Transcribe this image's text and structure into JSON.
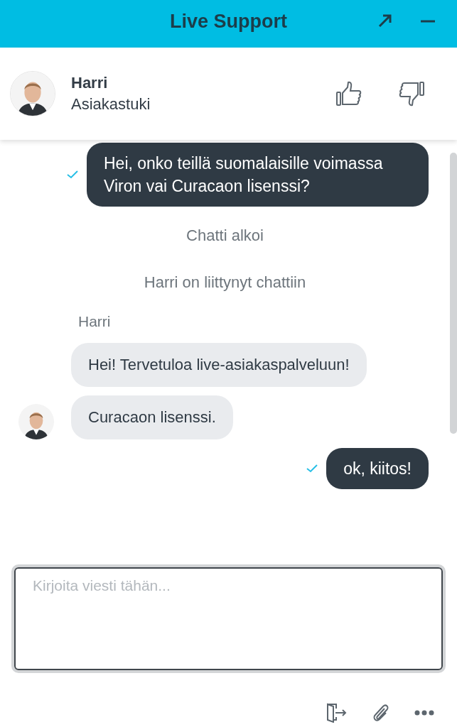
{
  "window": {
    "title": "Live Support"
  },
  "agent": {
    "name": "Harri",
    "role": "Asiakastuki"
  },
  "messages": [
    {
      "kind": "sent",
      "text": "Hei, onko teillä suomalaisille voimassa Viron vai Curacaon lisenssi?",
      "delivered": true
    },
    {
      "kind": "system",
      "text": "Chatti alkoi"
    },
    {
      "kind": "system",
      "text": "Harri on liittynyt chattiin"
    },
    {
      "kind": "sender",
      "text": "Harri"
    },
    {
      "kind": "received",
      "text": "Hei! Tervetuloa live-asiakaspalveluun!",
      "avatar": false
    },
    {
      "kind": "received",
      "text": "Curacaon lisenssi.",
      "avatar": true
    },
    {
      "kind": "sent",
      "text": "ok, kiitos!",
      "delivered": true
    }
  ],
  "composer": {
    "placeholder": "Kirjoita viesti tähän..."
  }
}
